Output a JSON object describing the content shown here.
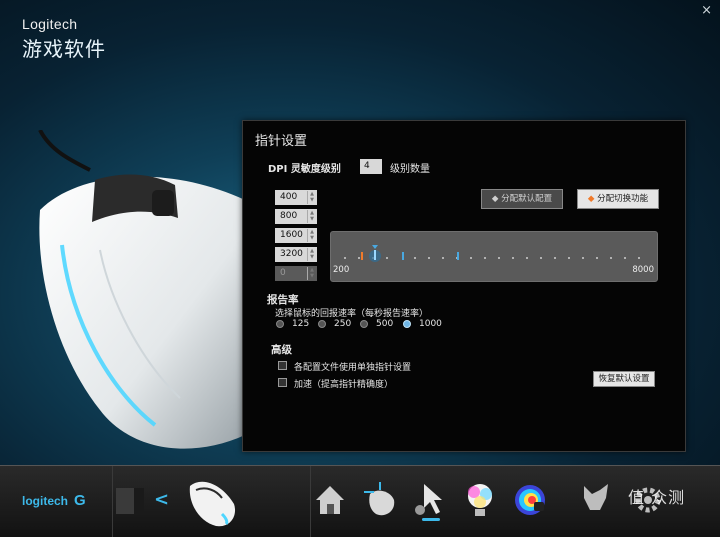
{
  "app": {
    "brand": "Logitech",
    "title": "游戏软件",
    "close": "×"
  },
  "panel": {
    "title": "指针设置",
    "dpi_label": "DPI 灵敏度级别",
    "dpi_count": "4",
    "dpi_count_label": "级别数量",
    "dpi_levels": [
      "400",
      "800",
      "1600",
      "3200",
      "0"
    ],
    "btn_default": "◆ 分配默认配置",
    "btn_shift": "分配切换功能",
    "slider_min": "200",
    "slider_max": "8000",
    "report_title": "报告率",
    "report_desc": "选择鼠标的回报速率（每秒报告速率）",
    "report_options": [
      "125",
      "250",
      "500",
      "1000"
    ],
    "report_selected": "1000",
    "advanced_title": "高级",
    "chk_per_profile": "各配置文件使用单独指针设置",
    "chk_accel": "加速（提高指针精确度）",
    "btn_restore": "恢复默认设置"
  },
  "bottom": {
    "logo": "logitech",
    "logo_mark": "G",
    "back_arrow": "<"
  },
  "watermark": "值 众测",
  "colors": {
    "accent": "#3db9ea",
    "orange_marker": "#f07a2a",
    "blue_marker": "#49a8e0"
  }
}
